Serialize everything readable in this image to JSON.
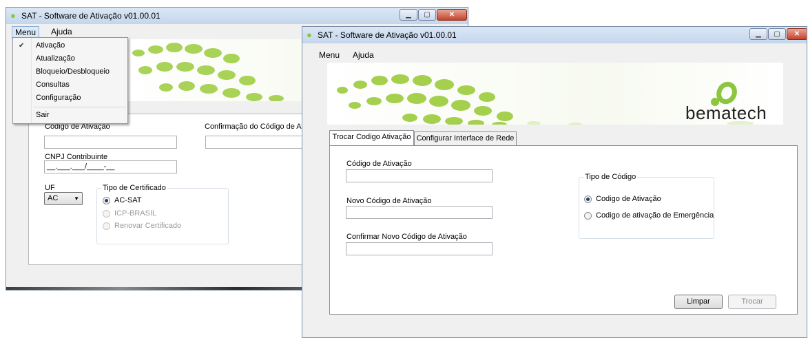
{
  "back_window": {
    "title": "SAT - Software de Ativação v01.00.01",
    "menu": {
      "items": [
        "Menu",
        "Ajuda"
      ],
      "dropdown": [
        {
          "label": "Ativação",
          "checked": true
        },
        {
          "label": "Atualização"
        },
        {
          "label": "Bloqueio/Desbloqueio"
        },
        {
          "label": "Consultas"
        },
        {
          "label": "Configuração"
        },
        {
          "label": "Sair"
        }
      ]
    },
    "form": {
      "codigo_label": "Código de Ativação",
      "confirmacao_label": "Confirmação do Código de Ativaçã",
      "cnpj_label": "CNPJ Contribuinte",
      "cnpj_placeholder": "__.___.___/____-__",
      "uf_label": "UF",
      "uf_value": "AC",
      "tipo_cert_label": "Tipo de Certificado",
      "cert_options": [
        {
          "label": "AC-SAT",
          "selected": true,
          "enabled": true
        },
        {
          "label": "ICP-BRASIL",
          "selected": false,
          "enabled": false
        },
        {
          "label": "Renovar Certificado",
          "selected": false,
          "enabled": false
        }
      ]
    }
  },
  "front_window": {
    "title": "SAT - Software de Ativação v01.00.01",
    "menu": [
      "Menu",
      "Ajuda"
    ],
    "brand": "bematech",
    "tabs": [
      {
        "label": "Trocar Codigo Ativação",
        "active": true
      },
      {
        "label": "Configurar Interface de Rede",
        "active": false
      }
    ],
    "form": {
      "codigo_label": "Código de Ativação",
      "novo_label": "Novo Código de Ativação",
      "confirmar_label": "Confirmar Novo Código de Ativação",
      "tipo_label": "Tipo de Código",
      "tipo_options": [
        {
          "label": "Codigo de Ativação",
          "selected": true
        },
        {
          "label": "Codigo de ativação de Emergência",
          "selected": false
        }
      ],
      "limpar_label": "Limpar",
      "trocar_label": "Trocar"
    }
  },
  "colors": {
    "brand_green": "#8cc63f",
    "titlebar": "#c9d9ee"
  }
}
